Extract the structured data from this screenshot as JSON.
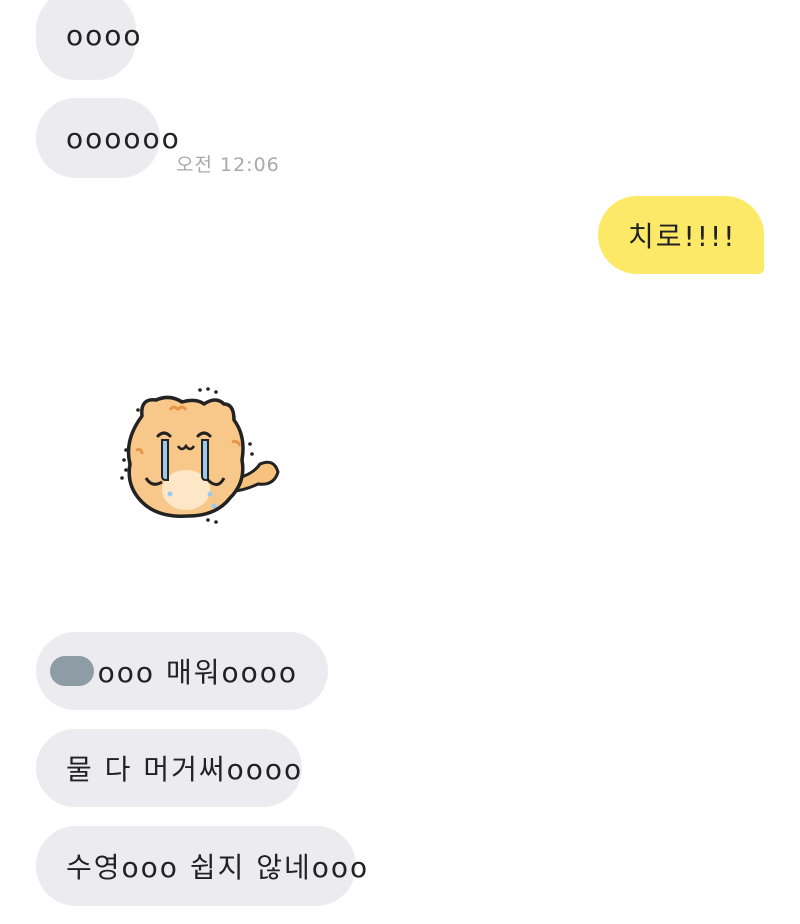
{
  "messages": [
    {
      "id": "m1",
      "side": "received",
      "text": "oooo"
    },
    {
      "id": "m2",
      "side": "received",
      "text": "oooooo",
      "time": "오전 12:06"
    },
    {
      "id": "m3",
      "side": "sent",
      "text": "치로!!!!"
    },
    {
      "id": "m4",
      "side": "received",
      "type": "sticker",
      "sticker_name": "crying-orange-cat-sticker"
    },
    {
      "id": "m5",
      "side": "received",
      "text": "ooo 매워oooo",
      "redacted_prefix": true
    },
    {
      "id": "m6",
      "side": "received",
      "text": "물 다 머거써oooo"
    },
    {
      "id": "m7",
      "side": "received",
      "text": "수영ooo 쉽지 않네ooo"
    }
  ],
  "colors": {
    "received_bubble": "#ececf0",
    "sent_bubble": "#fde968",
    "time_text": "#a9a9ad",
    "redaction": "#8e9ca5"
  }
}
